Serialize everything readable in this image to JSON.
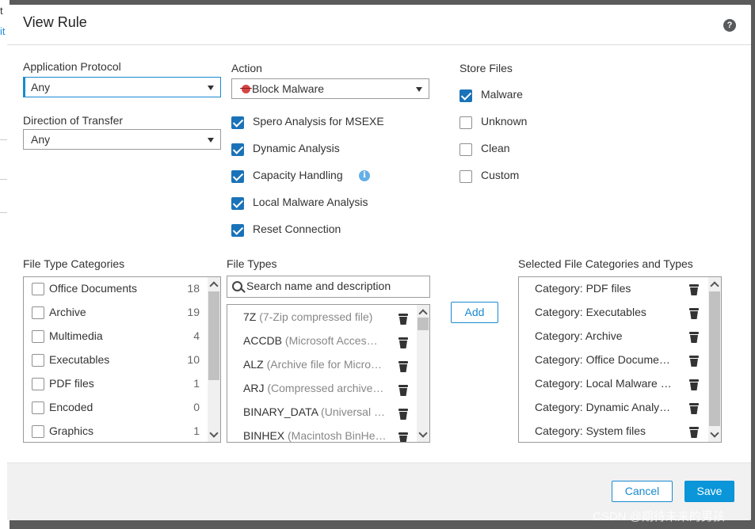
{
  "background": {
    "text_top": "t",
    "text_link": "it"
  },
  "dialog": {
    "title": "View Rule",
    "help_icon_label": "?"
  },
  "application_protocol": {
    "label": "Application Protocol",
    "value": "Any"
  },
  "direction": {
    "label": "Direction of Transfer",
    "value": "Any"
  },
  "action": {
    "label": "Action",
    "value": "Block Malware",
    "options": [
      {
        "label": "Spero Analysis for MSEXE",
        "checked": true
      },
      {
        "label": "Dynamic Analysis",
        "checked": true
      },
      {
        "label": "Capacity Handling",
        "checked": true,
        "info": "i"
      },
      {
        "label": "Local Malware Analysis",
        "checked": true
      },
      {
        "label": "Reset Connection",
        "checked": true
      }
    ]
  },
  "store_files": {
    "label": "Store Files",
    "options": [
      {
        "label": "Malware",
        "checked": true
      },
      {
        "label": "Unknown",
        "checked": false
      },
      {
        "label": "Clean",
        "checked": false
      },
      {
        "label": "Custom",
        "checked": false
      }
    ]
  },
  "file_type_categories": {
    "label": "File Type Categories",
    "items": [
      {
        "label": "Office Documents",
        "count": "18"
      },
      {
        "label": "Archive",
        "count": "19"
      },
      {
        "label": "Multimedia",
        "count": "4"
      },
      {
        "label": "Executables",
        "count": "10"
      },
      {
        "label": "PDF files",
        "count": "1"
      },
      {
        "label": "Encoded",
        "count": "0"
      },
      {
        "label": "Graphics",
        "count": "1"
      }
    ]
  },
  "file_types": {
    "label": "File Types",
    "search_placeholder": "Search name and description",
    "items": [
      {
        "code": "7Z",
        "desc": "(7-Zip compressed file)"
      },
      {
        "code": "ACCDB",
        "desc": "(Microsoft Acces…"
      },
      {
        "code": "ALZ",
        "desc": "(Archive file for Micro…"
      },
      {
        "code": "ARJ",
        "desc": "(Compressed archive…"
      },
      {
        "code": "BINARY_DATA",
        "desc": "(Universal …"
      },
      {
        "code": "BINHEX",
        "desc": "(Macintosh BinHe…"
      }
    ]
  },
  "add_button": "Add",
  "selected": {
    "label": "Selected File Categories and Types",
    "items": [
      "Category: PDF files",
      "Category: Executables",
      "Category: Archive",
      "Category: Office Docume…",
      "Category: Local Malware …",
      "Category: Dynamic Analy…",
      "Category: System files"
    ]
  },
  "footer": {
    "cancel": "Cancel",
    "save": "Save"
  },
  "watermark": "CSDN @期待未来的男孩",
  "colors": {
    "accent": "#1a8ad0",
    "checkbox_on": "#1a73b8",
    "primary_button": "#0a96d8",
    "info": "#64b0e6"
  }
}
